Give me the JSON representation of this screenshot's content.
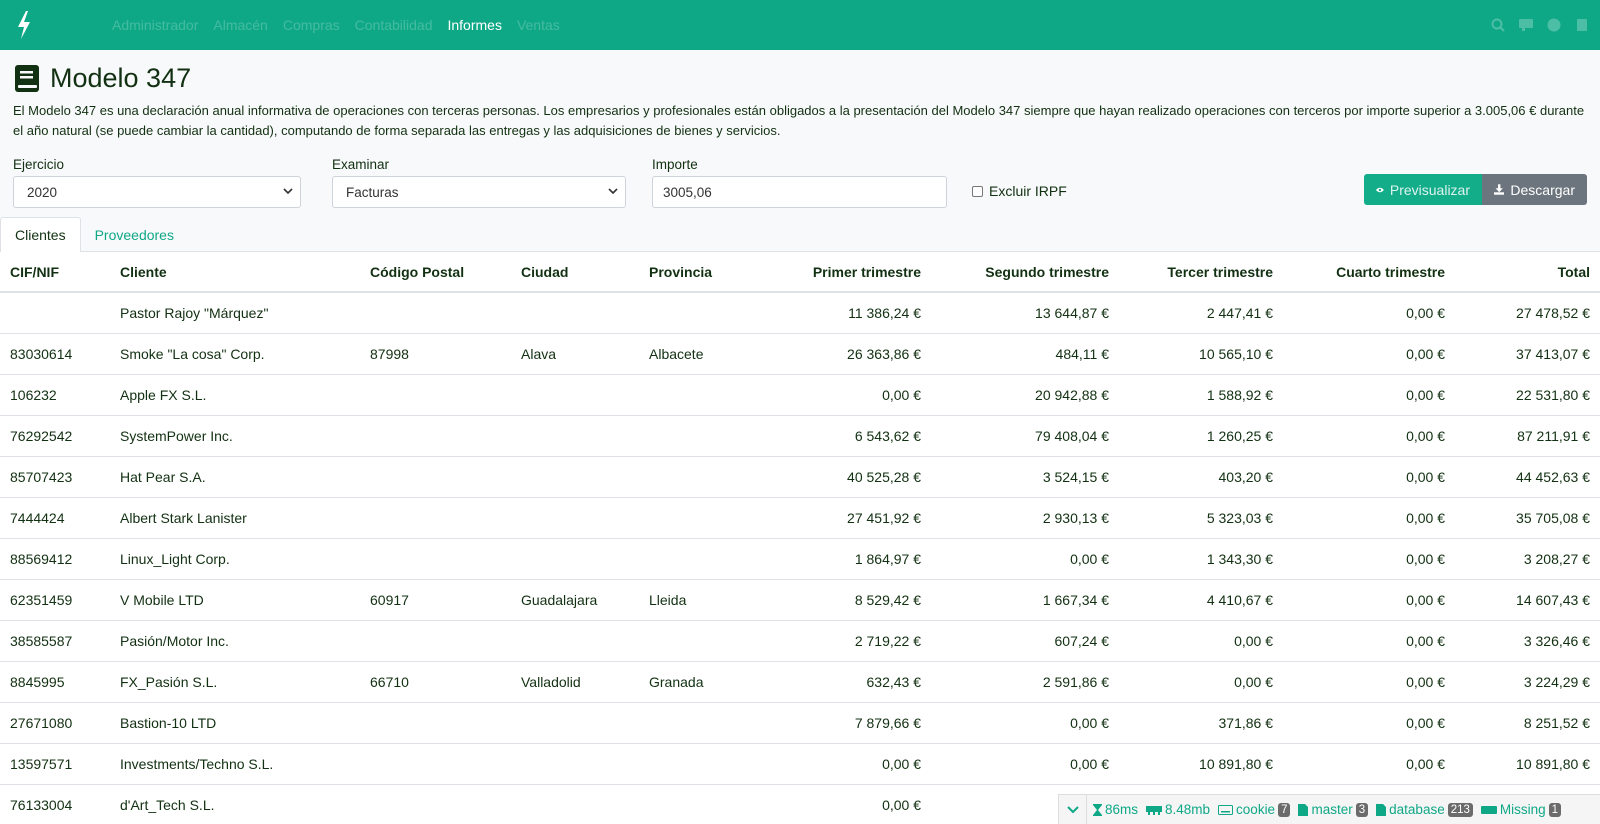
{
  "nav": {
    "items": [
      {
        "label": "Administrador"
      },
      {
        "label": "Almacén"
      },
      {
        "label": "Compras"
      },
      {
        "label": "Contabilidad"
      },
      {
        "label": "Informes"
      },
      {
        "label": "Ventas"
      }
    ],
    "active": "Informes",
    "right_icons": [
      "search-icon",
      "notes-icon",
      "help-icon",
      "user-icon"
    ]
  },
  "page": {
    "title": "Modelo 347",
    "icon": "book-icon",
    "description": "El Modelo 347 es una declaración anual informativa de operaciones con terceras personas. Los empresarios y profesionales están obligados a la presentación del Modelo 347 siempre que hayan realizado operaciones con terceros por importe superior a 3.005,06 € durante el año natural (se puede cambiar la cantidad), computando de forma separada las entregas y las adquisiciones de bienes y servicios."
  },
  "form": {
    "ejercicio": {
      "label": "Ejercicio",
      "value": "2020"
    },
    "examinar": {
      "label": "Examinar",
      "value": "Facturas"
    },
    "importe": {
      "label": "Importe",
      "value": "3005,06"
    },
    "excluir_irpf": {
      "label": "Excluir IRPF",
      "checked": false
    },
    "preview_label": "Previsualizar",
    "download_label": "Descargar"
  },
  "tabs": [
    {
      "label": "Clientes"
    },
    {
      "label": "Proveedores"
    }
  ],
  "active_tab": "Clientes",
  "table": {
    "headers": [
      "CIF/NIF",
      "Cliente",
      "Código Postal",
      "Ciudad",
      "Provincia",
      "Primer trimestre",
      "Segundo trimestre",
      "Tercer trimestre",
      "Cuarto trimestre",
      "Total"
    ],
    "rows": [
      [
        "",
        "Pastor Rajoy \"Márquez\"",
        "",
        "",
        "",
        "11 386,24 €",
        "13 644,87 €",
        "2 447,41 €",
        "0,00 €",
        "27 478,52 €"
      ],
      [
        "83030614",
        "Smoke \"La cosa\" Corp.",
        "87998",
        "Alava",
        "Albacete",
        "26 363,86 €",
        "484,11 €",
        "10 565,10 €",
        "0,00 €",
        "37 413,07 €"
      ],
      [
        "106232",
        "Apple FX S.L.",
        "",
        "",
        "",
        "0,00 €",
        "20 942,88 €",
        "1 588,92 €",
        "0,00 €",
        "22 531,80 €"
      ],
      [
        "76292542",
        "SystemPower Inc.",
        "",
        "",
        "",
        "6 543,62 €",
        "79 408,04 €",
        "1 260,25 €",
        "0,00 €",
        "87 211,91 €"
      ],
      [
        "85707423",
        "Hat Pear S.A.",
        "",
        "",
        "",
        "40 525,28 €",
        "3 524,15 €",
        "403,20 €",
        "0,00 €",
        "44 452,63 €"
      ],
      [
        "7444424",
        "Albert Stark Lanister",
        "",
        "",
        "",
        "27 451,92 €",
        "2 930,13 €",
        "5 323,03 €",
        "0,00 €",
        "35 705,08 €"
      ],
      [
        "88569412",
        "Linux_Light Corp.",
        "",
        "",
        "",
        "1 864,97 €",
        "0,00 €",
        "1 343,30 €",
        "0,00 €",
        "3 208,27 €"
      ],
      [
        "62351459",
        "V Mobile LTD",
        "60917",
        "Guadalajara",
        "Lleida",
        "8 529,42 €",
        "1 667,34 €",
        "4 410,67 €",
        "0,00 €",
        "14 607,43 €"
      ],
      [
        "38585587",
        "Pasión/Motor Inc.",
        "",
        "",
        "",
        "2 719,22 €",
        "607,24 €",
        "0,00 €",
        "0,00 €",
        "3 326,46 €"
      ],
      [
        "8845995",
        "FX_Pasión S.L.",
        "66710",
        "Valladolid",
        "Granada",
        "632,43 €",
        "2 591,86 €",
        "0,00 €",
        "0,00 €",
        "3 224,29 €"
      ],
      [
        "27671080",
        "Bastion-10 LTD",
        "",
        "",
        "",
        "7 879,66 €",
        "0,00 €",
        "371,86 €",
        "0,00 €",
        "8 251,52 €"
      ],
      [
        "13597571",
        "Investments/Techno S.L.",
        "",
        "",
        "",
        "0,00 €",
        "0,00 €",
        "10 891,80 €",
        "0,00 €",
        "10 891,80 €"
      ],
      [
        "76133004",
        "d'Art_Tech S.L.",
        "",
        "",
        "",
        "0,00 €",
        "",
        "",
        "",
        ""
      ]
    ]
  },
  "debugbar": {
    "time": "86ms",
    "memory": "8.48mb",
    "cookie": {
      "label": "cookie",
      "count": "7"
    },
    "master": {
      "label": "master",
      "count": "3"
    },
    "database": {
      "label": "database",
      "count": "213"
    },
    "missing": {
      "label": "Missing",
      "count": "1"
    }
  },
  "colors": {
    "brand": "#0fa887",
    "text": "#123012",
    "secondary": "#6c757d"
  }
}
